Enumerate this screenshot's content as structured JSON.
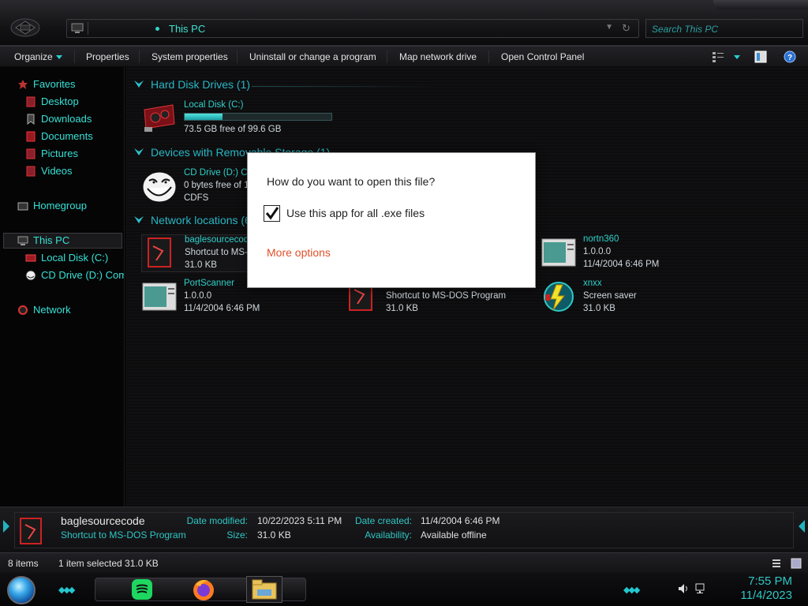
{
  "address": {
    "crumb": "This PC"
  },
  "search": {
    "placeholder": "Search This PC"
  },
  "toolbar": {
    "organize": "Organize",
    "properties": "Properties",
    "system_properties": "System properties",
    "uninstall": "Uninstall or change a program",
    "map_drive": "Map network drive",
    "control_panel": "Open Control Panel"
  },
  "sidebar": {
    "favorites": "Favorites",
    "desktop": "Desktop",
    "downloads": "Downloads",
    "documents": "Documents",
    "pictures": "Pictures",
    "videos": "Videos",
    "homegroup": "Homegroup",
    "this_pc": "This PC",
    "local_disk": "Local Disk (C:)",
    "cd_drive": "CD Drive (D:) Com",
    "network": "Network"
  },
  "groups": {
    "hdd": "Hard Disk Drives (1)",
    "removable": "Devices with Removable Storage (1)",
    "network": "Network locations (6)"
  },
  "drives": {
    "c": {
      "name": "Local Disk (C:)",
      "free": "73.5 GB free of 99.6 GB",
      "used_fraction": 0.26
    },
    "d": {
      "name": "CD Drive (D:) Co",
      "free": "0 bytes free of 1.",
      "fs": "CDFS"
    }
  },
  "network_items": [
    {
      "name": "baglesourcecode",
      "line2": "Shortcut to MS-",
      "line3": "31.0 KB"
    },
    {
      "name": "nortn360",
      "line2": "1.0.0.0",
      "line3": "11/4/2004 6:46 PM"
    },
    {
      "name": "PortScanner",
      "line2": "1.0.0.0",
      "line3": "11/4/2004 6:46 PM"
    },
    {
      "name": "",
      "line2": "Shortcut to MS-DOS Program",
      "line3": "31.0 KB"
    },
    {
      "name": "xnxx",
      "line2": "Screen saver",
      "line3": "31.0 KB"
    }
  ],
  "dialog": {
    "question": "How do you want to open this file?",
    "checkbox_label": "Use this app for all .exe files",
    "checked": true,
    "more": "More options"
  },
  "details": {
    "name": "baglesourcecode",
    "type": "Shortcut to MS-DOS Program",
    "date_modified_label": "Date modified:",
    "date_modified": "10/22/2023 5:11 PM",
    "size_label": "Size:",
    "size": "31.0 KB",
    "date_created_label": "Date created:",
    "date_created": "11/4/2004 6:46 PM",
    "availability_label": "Availability:",
    "availability": "Available offline"
  },
  "status": {
    "items": "8 items",
    "selected": "1 item selected  31.0 KB"
  },
  "clock": {
    "time": "7:55 PM",
    "date": "11/4/2023"
  },
  "colors": {
    "accent": "#2fd0c8",
    "link": "#e1502a",
    "background": "#0c0c0d"
  }
}
